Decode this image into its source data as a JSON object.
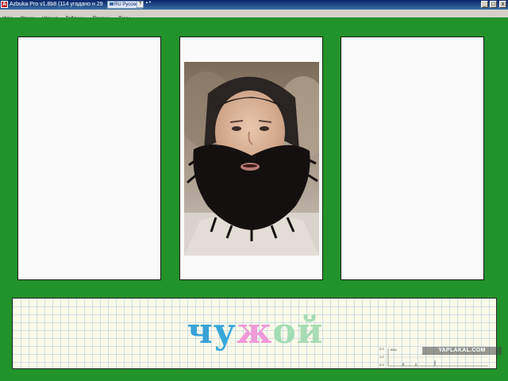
{
  "window": {
    "title": "Azbuka Pro v1.8b8 (114 угадано н 29",
    "app_icon_label": "A",
    "language": "RU Русский",
    "help_label": "?",
    "scroll_arrows": "▲▼",
    "minimize_label": "_",
    "maximize_label": "□",
    "close_label": "x"
  },
  "menu": {
    "items": [
      "Игра",
      "Опции",
      "Чтение",
      "Таблицы",
      "Помощь",
      "Темы"
    ]
  },
  "cards": [
    {
      "has_image": false
    },
    {
      "has_image": true,
      "image": "bearded-child-photo"
    },
    {
      "has_image": false
    }
  ],
  "word": {
    "letters": [
      "ч",
      "у",
      "ж",
      "о",
      "й"
    ],
    "letter_colors": [
      "#39a2d6",
      "#38a7dc",
      "#ef9ad8",
      "#a4dcb6",
      "#a8dcb6"
    ]
  },
  "mini_graph": {
    "y_ticks": [
      "2.0",
      "1.0",
      "0.0"
    ],
    "corner_label": "КБ/с"
  },
  "watermark": "YAPLAKAL.COM",
  "colors": {
    "background_green": "#22922a",
    "card": "#fafafa",
    "word_panel": "#fbfaea"
  }
}
